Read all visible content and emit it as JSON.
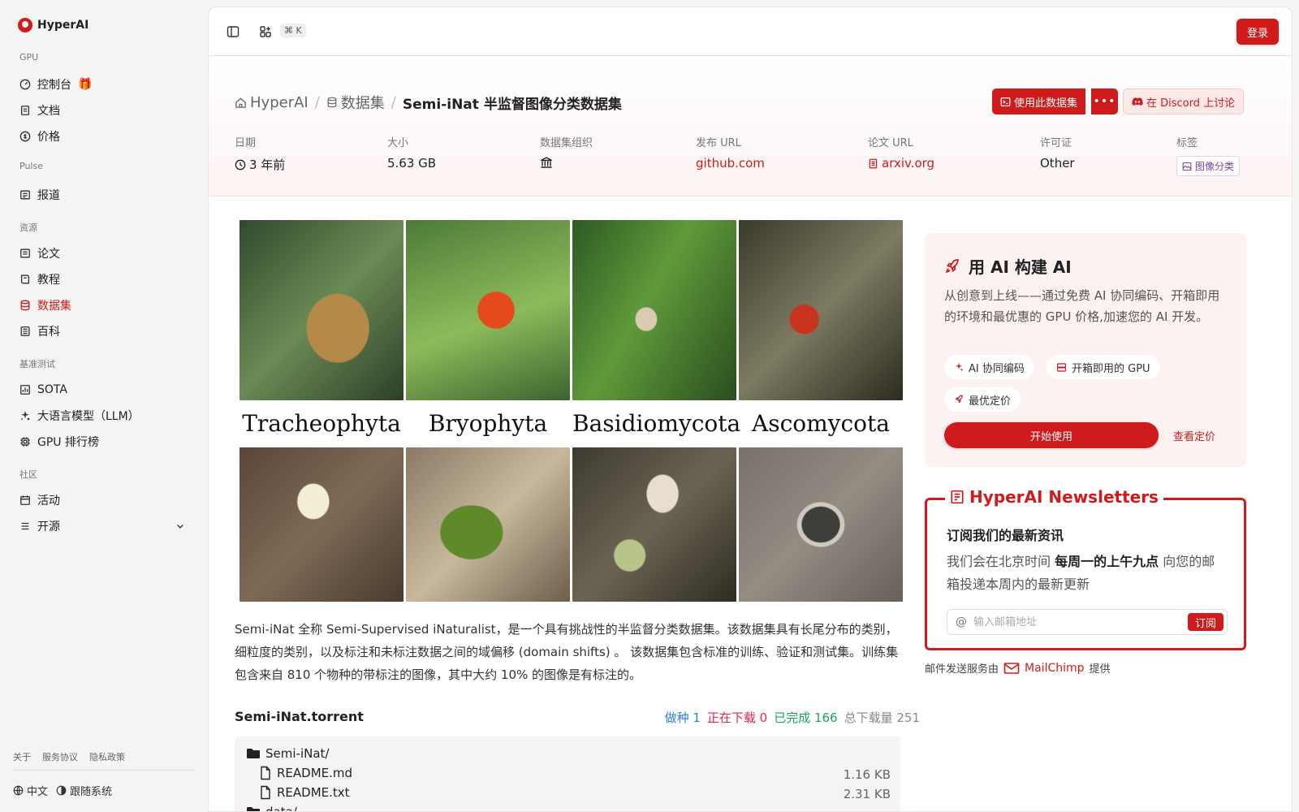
{
  "app": {
    "name": "HyperAI"
  },
  "sidebar": {
    "groups": [
      {
        "label": "GPU",
        "items": [
          {
            "label": "控制台"
          },
          {
            "label": "文档"
          },
          {
            "label": "价格"
          }
        ]
      },
      {
        "label": "Pulse",
        "items": [
          {
            "label": "报道"
          }
        ]
      },
      {
        "label": "资源",
        "items": [
          {
            "label": "论文"
          },
          {
            "label": "教程"
          },
          {
            "label": "数据集",
            "active": true
          },
          {
            "label": "百科"
          }
        ]
      },
      {
        "label": "基准测试",
        "items": [
          {
            "label": "SOTA"
          },
          {
            "label": "大语言模型（LLM）"
          },
          {
            "label": "GPU 排行榜"
          }
        ]
      },
      {
        "label": "社区",
        "items": [
          {
            "label": "活动"
          },
          {
            "label": "开源"
          }
        ]
      }
    ],
    "footer_links": [
      "关于",
      "服务协议",
      "隐私政策"
    ],
    "language": "中文",
    "theme": "跟随系统"
  },
  "topbar": {
    "shortcut": "⌘ K",
    "login": "登录"
  },
  "breadcrumb": {
    "home": "HyperAI",
    "section": "数据集",
    "current": "Semi-iNat 半监督图像分类数据集"
  },
  "actions": {
    "use_dataset": "使用此数据集",
    "discuss": "在 Discord 上讨论"
  },
  "meta": {
    "date_label": "日期",
    "date_value": "3 年前",
    "size_label": "大小",
    "size_value": "5.63 GB",
    "org_label": "数据集组织",
    "release_label": "发布 URL",
    "release_value": "github.com",
    "paper_label": "论文 URL",
    "paper_value": "arxiv.org",
    "license_label": "许可证",
    "license_value": "Other",
    "tags_label": "标签",
    "tag_value": "图像分类"
  },
  "figure": {
    "categories": [
      "Tracheophyta",
      "Bryophyta",
      "Basidiomycota",
      "Ascomycota"
    ]
  },
  "description": "Semi-iNat 全称 Semi-Supervised iNaturalist，是一个具有挑战性的半监督分类数据集。该数据集具有长尾分布的类别，细粒度的类别，以及标注和未标注数据之间的域偏移 (domain shifts) 。 该数据集包含标准的训练、验证和测试集。训练集包含来自 810 个物种的带标注的图像，其中大约 10% 的图像是有标注的。",
  "torrent": {
    "title": "Semi-iNat.torrent",
    "seeding": "做种 1",
    "downloading": "正在下载 0",
    "completed": "已完成 166",
    "total": "总下载量 251",
    "files": [
      {
        "name": "Semi-iNat/",
        "size": ""
      },
      {
        "name": "README.md",
        "size": "1.16 KB"
      },
      {
        "name": "README.txt",
        "size": "2.31 KB"
      },
      {
        "name": "data/",
        "size": ""
      }
    ]
  },
  "ai_card": {
    "title": "用 AI 构建 AI",
    "body": "从创意到上线——通过免费 AI 协同编码、开箱即用的环境和最优惠的 GPU 价格,加速您的 AI 开发。",
    "chips": [
      "AI 协同编码",
      "开箱即用的 GPU",
      "最优定价"
    ],
    "start": "开始使用",
    "pricing": "查看定价"
  },
  "newsletter": {
    "title": "HyperAI Newsletters",
    "subtitle": "订阅我们的最新资讯",
    "body_prefix": "我们会在北京时间 ",
    "body_bold": "每周一的上午九点",
    "body_suffix": " 向您的邮箱投递本周内的最新更新",
    "placeholder": "输入邮箱地址",
    "subscribe": "订阅",
    "note_prefix": "邮件发送服务由",
    "provider": "MailChimp",
    "note_suffix": "提供"
  },
  "colors": {
    "accent": "#cf1b1b",
    "seeding": "#2f7de1",
    "downloading": "#e0284a",
    "completed": "#1aa35a",
    "total": "#888888"
  }
}
